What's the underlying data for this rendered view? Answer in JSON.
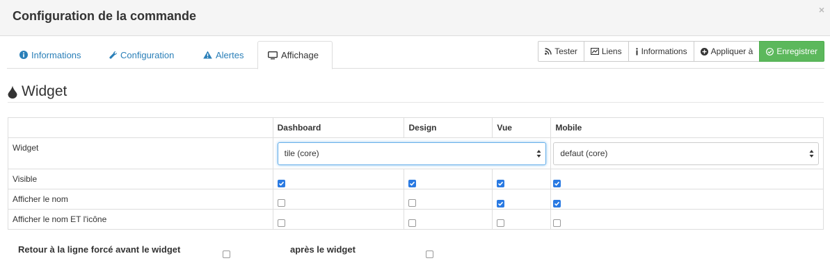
{
  "modal": {
    "title": "Configuration de la commande"
  },
  "tabs": [
    {
      "label": "Informations",
      "icon": "info-circle-icon"
    },
    {
      "label": "Configuration",
      "icon": "wrench-icon"
    },
    {
      "label": "Alertes",
      "icon": "warning-icon"
    },
    {
      "label": "Affichage",
      "icon": "monitor-icon",
      "active": true
    }
  ],
  "toolbar": {
    "tester": "Tester",
    "liens": "Liens",
    "informations": "Informations",
    "appliquer": "Appliquer à",
    "enregistrer": "Enregistrer"
  },
  "section": {
    "title": "Widget"
  },
  "table": {
    "headers": [
      "Dashboard",
      "Design",
      "Vue",
      "Mobile"
    ],
    "widget_label": "Widget",
    "widget_select_main": "tile (core)",
    "widget_select_mobile": "defaut (core)",
    "rows": [
      {
        "label": "Visible",
        "checks": [
          true,
          true,
          true,
          true
        ]
      },
      {
        "label": "Afficher le nom",
        "checks": [
          false,
          false,
          true,
          true
        ]
      },
      {
        "label": "Afficher le nom ET l'icône",
        "checks": [
          false,
          false,
          false,
          false
        ]
      }
    ]
  },
  "footer": {
    "before_label": "Retour à la ligne forcé avant le widget",
    "after_label": "après le widget",
    "before_checked": false,
    "after_checked": false
  },
  "colors": {
    "success": "#5cb85c",
    "link": "#2a7fb8",
    "check": "#2a7ae2"
  }
}
